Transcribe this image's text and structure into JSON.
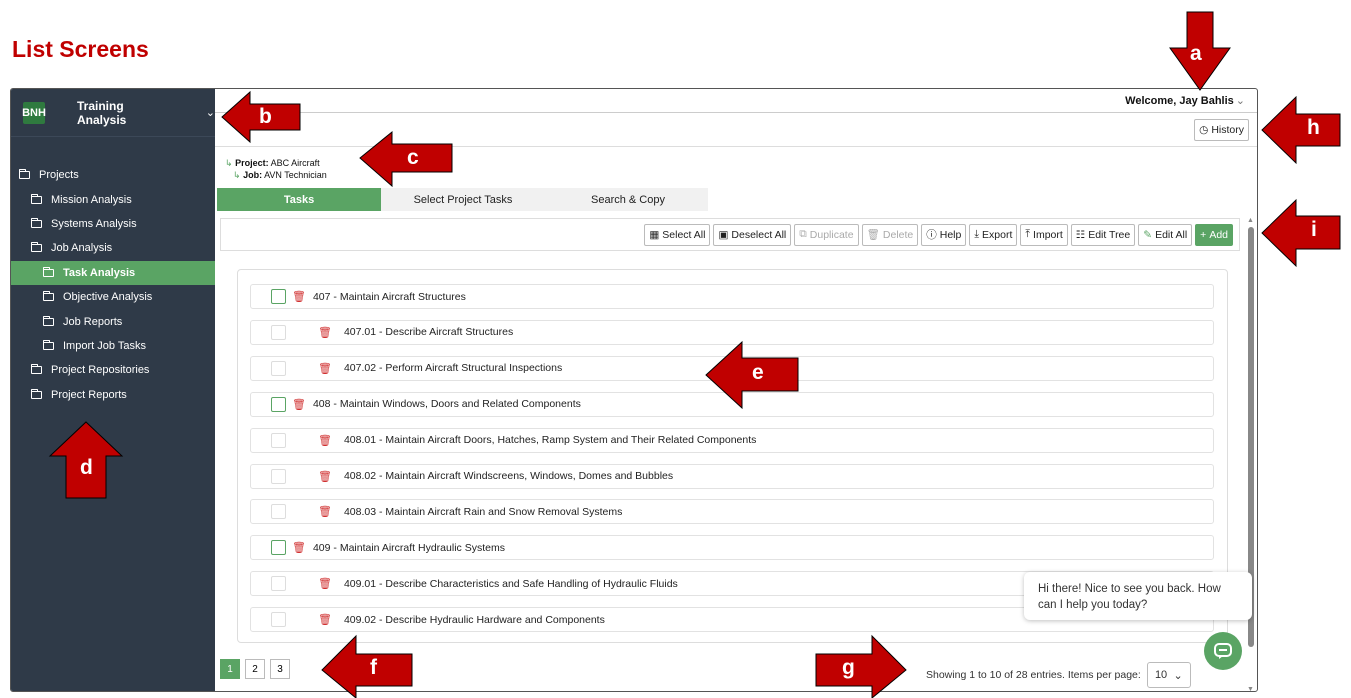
{
  "doc_title": "List Screens",
  "brand": {
    "logo": "BNH",
    "name": "Training Analysis"
  },
  "sidebar": {
    "items": [
      {
        "label": "Projects",
        "level": 0
      },
      {
        "label": "Mission Analysis",
        "level": 1
      },
      {
        "label": "Systems Analysis",
        "level": 1
      },
      {
        "label": "Job Analysis",
        "level": 1
      },
      {
        "label": "Task Analysis",
        "level": 2,
        "active": true
      },
      {
        "label": "Objective Analysis",
        "level": 2
      },
      {
        "label": "Job Reports",
        "level": 2
      },
      {
        "label": "Import Job Tasks",
        "level": 2
      },
      {
        "label": "Project Repositories",
        "level": 1
      },
      {
        "label": "Project Reports",
        "level": 1
      }
    ]
  },
  "header": {
    "welcome": "Welcome, Jay Bahlis",
    "history": "History"
  },
  "breadcrumb": {
    "project_label": "Project:",
    "project": "ABC Aircraft",
    "job_label": "Job:",
    "job": "AVN Technician"
  },
  "tabs": [
    "Tasks",
    "Select Project Tasks",
    "Search & Copy"
  ],
  "toolbar": {
    "select_all": "Select All",
    "deselect_all": "Deselect All",
    "duplicate": "Duplicate",
    "delete": "Delete",
    "help": "Help",
    "export": "Export",
    "import": "Import",
    "edit_tree": "Edit Tree",
    "edit_all": "Edit All",
    "add": "Add"
  },
  "rows": [
    {
      "text": "407 - Maintain Aircraft Structures",
      "parent": true
    },
    {
      "text": "407.01 - Describe Aircraft Structures",
      "parent": false
    },
    {
      "text": "407.02 - Perform Aircraft Structural Inspections",
      "parent": false
    },
    {
      "text": "408 - Maintain Windows, Doors and Related Components",
      "parent": true
    },
    {
      "text": "408.01 - Maintain Aircraft Doors, Hatches, Ramp System and Their Related Components",
      "parent": false
    },
    {
      "text": "408.02 - Maintain Aircraft Windscreens, Windows, Domes and Bubbles",
      "parent": false
    },
    {
      "text": "408.03 - Maintain Aircraft Rain and Snow Removal Systems",
      "parent": false
    },
    {
      "text": "409 - Maintain Aircraft Hydraulic Systems",
      "parent": true
    },
    {
      "text": "409.01 - Describe Characteristics and Safe Handling of Hydraulic Fluids",
      "parent": false
    },
    {
      "text": "409.02 - Describe Hydraulic Hardware and Components",
      "parent": false
    }
  ],
  "pagination": {
    "pages": [
      "1",
      "2",
      "3"
    ],
    "current": "1"
  },
  "summary": {
    "showing": "Showing 1 to 10 of 28 entries. Items per page:",
    "per_page": "10"
  },
  "chat": {
    "message": "Hi there! Nice to see you back. How can I help you today?"
  },
  "annotations": [
    "a",
    "b",
    "c",
    "d",
    "e",
    "f",
    "g",
    "h",
    "i"
  ],
  "colors": {
    "accent": "#5aa464",
    "sidebar": "#2f3a48",
    "annotation": "#c00000",
    "title": "#c00000",
    "delete": "#d03030"
  }
}
